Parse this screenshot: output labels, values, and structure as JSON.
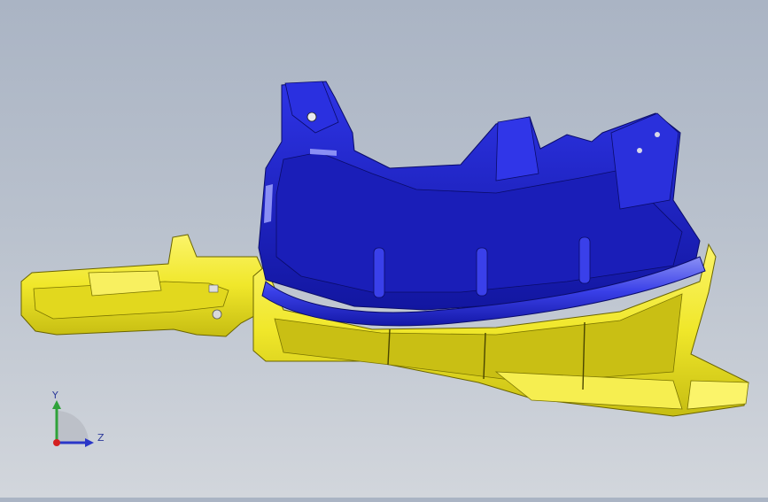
{
  "viewport": {
    "background_top": "#aab4c4",
    "background_bottom": "#d2d6dc",
    "part_colors": {
      "blue_shell": "#1f23c8",
      "blue_dark": "#1216a0",
      "blue_light": "#4c52ee",
      "yellow_shell": "#f0e72a",
      "yellow_dark": "#c6bd12",
      "yellow_light": "#fbf46a"
    }
  },
  "triad": {
    "y_label": "Y",
    "z_label": "Z",
    "y_color": "#2fa23a",
    "z_color": "#2a36c8",
    "x_color": "#d42020"
  }
}
